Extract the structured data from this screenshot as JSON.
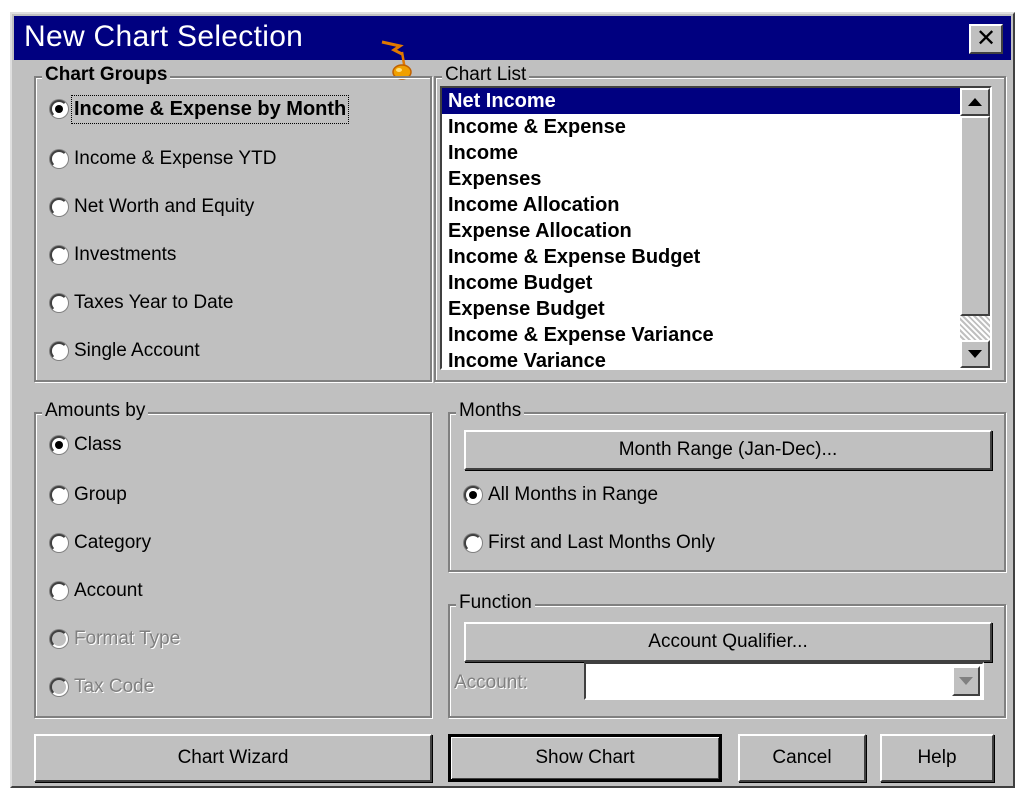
{
  "window": {
    "title": "New Chart Selection",
    "close_label": "✕"
  },
  "chart_groups": {
    "legend": "Chart Groups",
    "options": [
      {
        "label": "Income & Expense by Month",
        "checked": true
      },
      {
        "label": "Income & Expense YTD",
        "checked": false
      },
      {
        "label": "Net Worth and Equity",
        "checked": false
      },
      {
        "label": "Investments",
        "checked": false
      },
      {
        "label": "Taxes Year to Date",
        "checked": false
      },
      {
        "label": "Single Account",
        "checked": false
      }
    ]
  },
  "chart_list": {
    "legend": "Chart List",
    "items": [
      "Net Income",
      "Income & Expense",
      "Income",
      "Expenses",
      "Income Allocation",
      "Expense Allocation",
      "Income & Expense Budget",
      "Income Budget",
      "Expense Budget",
      "Income & Expense Variance",
      "Income Variance"
    ],
    "selected": "Net Income"
  },
  "amounts_by": {
    "legend": "Amounts by",
    "options": [
      {
        "label": "Class",
        "checked": true,
        "enabled": true
      },
      {
        "label": "Group",
        "checked": false,
        "enabled": true
      },
      {
        "label": "Category",
        "checked": false,
        "enabled": true
      },
      {
        "label": "Account",
        "checked": false,
        "enabled": true
      },
      {
        "label": "Format Type",
        "checked": false,
        "enabled": false
      },
      {
        "label": "Tax Code",
        "checked": false,
        "enabled": false
      }
    ]
  },
  "months": {
    "legend": "Months",
    "range_button": "Month Range (Jan-Dec)...",
    "options": [
      {
        "label": "All Months in Range",
        "checked": true
      },
      {
        "label": "First and Last Months Only",
        "checked": false
      }
    ]
  },
  "function": {
    "legend": "Function",
    "qualifier_button": "Account Qualifier...",
    "account_label": "Account:",
    "account_value": ""
  },
  "buttons": {
    "chart_wizard": "Chart Wizard",
    "show_chart": "Show Chart",
    "cancel": "Cancel",
    "help": "Help"
  },
  "icons": {
    "title_decoration": "music-note-icon"
  }
}
